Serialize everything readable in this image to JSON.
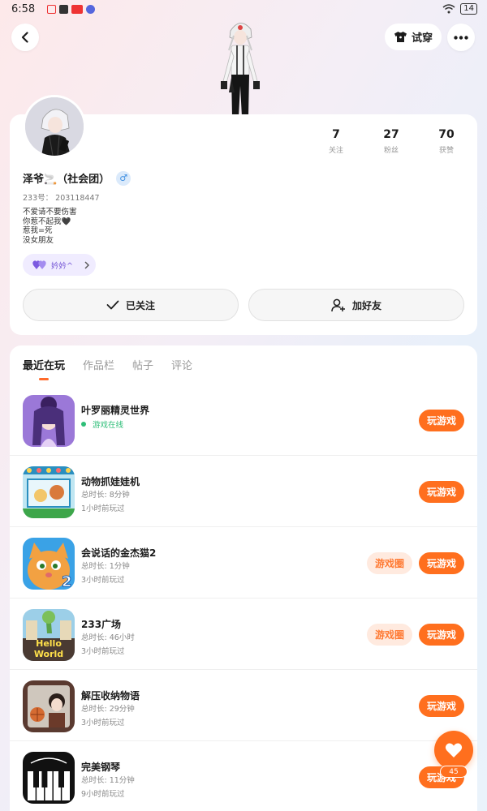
{
  "status_bar": {
    "time": "6:58",
    "battery": "14"
  },
  "header": {
    "tryon_label": "试穿"
  },
  "profile": {
    "username": "泽爷🚬（社会团）",
    "gender_symbol": "♂",
    "uid": "233号：  203118447",
    "bio_lines": [
      "不爱请不要伤害",
      "你惹不起我🖤",
      "惹我=死",
      "没女朋友"
    ],
    "tag_label": "妗妗^"
  },
  "stats": [
    {
      "value": "7",
      "label": "关注"
    },
    {
      "value": "27",
      "label": "粉丝"
    },
    {
      "value": "70",
      "label": "获赞"
    }
  ],
  "actions": {
    "follow_label": "已关注",
    "add_friend_label": "加好友"
  },
  "tabs": [
    "最近在玩",
    "作品栏",
    "帖子",
    "评论"
  ],
  "games": [
    {
      "name": "叶罗丽精灵世界",
      "status": "游戏在线",
      "play_label": "玩游戏"
    },
    {
      "name": "动物抓娃娃机",
      "duration": "总时长:  8分钟",
      "last_played": "1小时前玩过",
      "play_label": "玩游戏"
    },
    {
      "name": "会说话的金杰猫2",
      "duration": "总时长:  1分钟",
      "last_played": "3小时前玩过",
      "circle_label": "游戏圈",
      "play_label": "玩游戏"
    },
    {
      "name": "233广场",
      "duration": "总时长:  46小时",
      "last_played": "3小时前玩过",
      "circle_label": "游戏圈",
      "play_label": "玩游戏"
    },
    {
      "name": "解压收纳物语",
      "duration": "总时长:  29分钟",
      "last_played": "3小时前玩过",
      "play_label": "玩游戏"
    },
    {
      "name": "完美钢琴",
      "duration": "总时长:  11分钟",
      "last_played": "9小时前玩过",
      "play_label": "玩游戏"
    }
  ],
  "fab": {
    "badge": "45"
  },
  "colors": {
    "accent": "#ff6f1e",
    "online": "#2ebe78",
    "tag": "#7556d6"
  },
  "icons": [
    "back-arrow-icon",
    "tshirt-icon",
    "more-dots-icon",
    "heart-icon",
    "checkmark-icon",
    "add-user-icon",
    "chevron-right-icon",
    "wifi-icon"
  ]
}
